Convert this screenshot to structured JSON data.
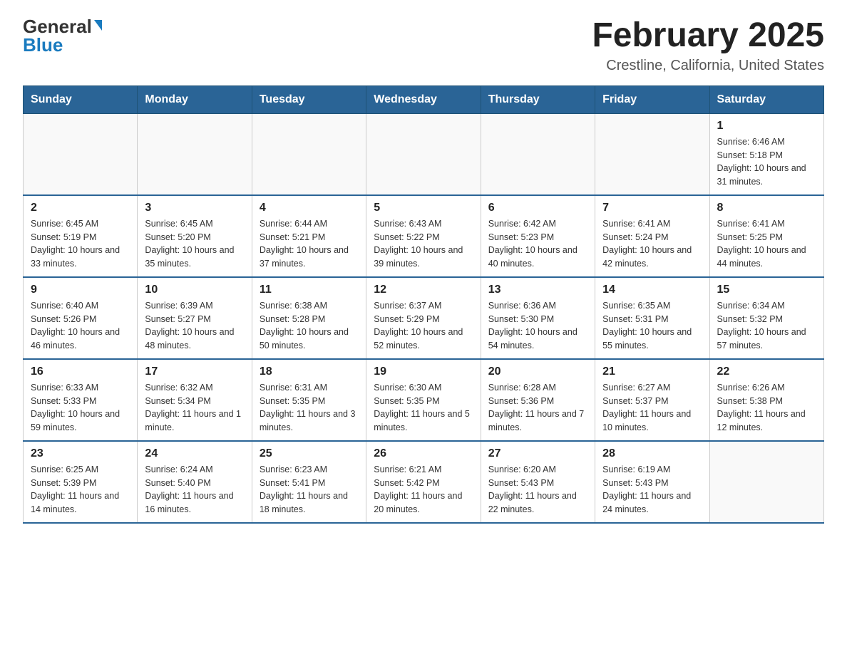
{
  "logo": {
    "general": "General",
    "blue": "Blue",
    "triangle": "▲"
  },
  "title": "February 2025",
  "subtitle": "Crestline, California, United States",
  "days_header": [
    "Sunday",
    "Monday",
    "Tuesday",
    "Wednesday",
    "Thursday",
    "Friday",
    "Saturday"
  ],
  "weeks": [
    [
      {
        "day": "",
        "info": ""
      },
      {
        "day": "",
        "info": ""
      },
      {
        "day": "",
        "info": ""
      },
      {
        "day": "",
        "info": ""
      },
      {
        "day": "",
        "info": ""
      },
      {
        "day": "",
        "info": ""
      },
      {
        "day": "1",
        "info": "Sunrise: 6:46 AM\nSunset: 5:18 PM\nDaylight: 10 hours and 31 minutes."
      }
    ],
    [
      {
        "day": "2",
        "info": "Sunrise: 6:45 AM\nSunset: 5:19 PM\nDaylight: 10 hours and 33 minutes."
      },
      {
        "day": "3",
        "info": "Sunrise: 6:45 AM\nSunset: 5:20 PM\nDaylight: 10 hours and 35 minutes."
      },
      {
        "day": "4",
        "info": "Sunrise: 6:44 AM\nSunset: 5:21 PM\nDaylight: 10 hours and 37 minutes."
      },
      {
        "day": "5",
        "info": "Sunrise: 6:43 AM\nSunset: 5:22 PM\nDaylight: 10 hours and 39 minutes."
      },
      {
        "day": "6",
        "info": "Sunrise: 6:42 AM\nSunset: 5:23 PM\nDaylight: 10 hours and 40 minutes."
      },
      {
        "day": "7",
        "info": "Sunrise: 6:41 AM\nSunset: 5:24 PM\nDaylight: 10 hours and 42 minutes."
      },
      {
        "day": "8",
        "info": "Sunrise: 6:41 AM\nSunset: 5:25 PM\nDaylight: 10 hours and 44 minutes."
      }
    ],
    [
      {
        "day": "9",
        "info": "Sunrise: 6:40 AM\nSunset: 5:26 PM\nDaylight: 10 hours and 46 minutes."
      },
      {
        "day": "10",
        "info": "Sunrise: 6:39 AM\nSunset: 5:27 PM\nDaylight: 10 hours and 48 minutes."
      },
      {
        "day": "11",
        "info": "Sunrise: 6:38 AM\nSunset: 5:28 PM\nDaylight: 10 hours and 50 minutes."
      },
      {
        "day": "12",
        "info": "Sunrise: 6:37 AM\nSunset: 5:29 PM\nDaylight: 10 hours and 52 minutes."
      },
      {
        "day": "13",
        "info": "Sunrise: 6:36 AM\nSunset: 5:30 PM\nDaylight: 10 hours and 54 minutes."
      },
      {
        "day": "14",
        "info": "Sunrise: 6:35 AM\nSunset: 5:31 PM\nDaylight: 10 hours and 55 minutes."
      },
      {
        "day": "15",
        "info": "Sunrise: 6:34 AM\nSunset: 5:32 PM\nDaylight: 10 hours and 57 minutes."
      }
    ],
    [
      {
        "day": "16",
        "info": "Sunrise: 6:33 AM\nSunset: 5:33 PM\nDaylight: 10 hours and 59 minutes."
      },
      {
        "day": "17",
        "info": "Sunrise: 6:32 AM\nSunset: 5:34 PM\nDaylight: 11 hours and 1 minute."
      },
      {
        "day": "18",
        "info": "Sunrise: 6:31 AM\nSunset: 5:35 PM\nDaylight: 11 hours and 3 minutes."
      },
      {
        "day": "19",
        "info": "Sunrise: 6:30 AM\nSunset: 5:35 PM\nDaylight: 11 hours and 5 minutes."
      },
      {
        "day": "20",
        "info": "Sunrise: 6:28 AM\nSunset: 5:36 PM\nDaylight: 11 hours and 7 minutes."
      },
      {
        "day": "21",
        "info": "Sunrise: 6:27 AM\nSunset: 5:37 PM\nDaylight: 11 hours and 10 minutes."
      },
      {
        "day": "22",
        "info": "Sunrise: 6:26 AM\nSunset: 5:38 PM\nDaylight: 11 hours and 12 minutes."
      }
    ],
    [
      {
        "day": "23",
        "info": "Sunrise: 6:25 AM\nSunset: 5:39 PM\nDaylight: 11 hours and 14 minutes."
      },
      {
        "day": "24",
        "info": "Sunrise: 6:24 AM\nSunset: 5:40 PM\nDaylight: 11 hours and 16 minutes."
      },
      {
        "day": "25",
        "info": "Sunrise: 6:23 AM\nSunset: 5:41 PM\nDaylight: 11 hours and 18 minutes."
      },
      {
        "day": "26",
        "info": "Sunrise: 6:21 AM\nSunset: 5:42 PM\nDaylight: 11 hours and 20 minutes."
      },
      {
        "day": "27",
        "info": "Sunrise: 6:20 AM\nSunset: 5:43 PM\nDaylight: 11 hours and 22 minutes."
      },
      {
        "day": "28",
        "info": "Sunrise: 6:19 AM\nSunset: 5:43 PM\nDaylight: 11 hours and 24 minutes."
      },
      {
        "day": "",
        "info": ""
      }
    ]
  ]
}
